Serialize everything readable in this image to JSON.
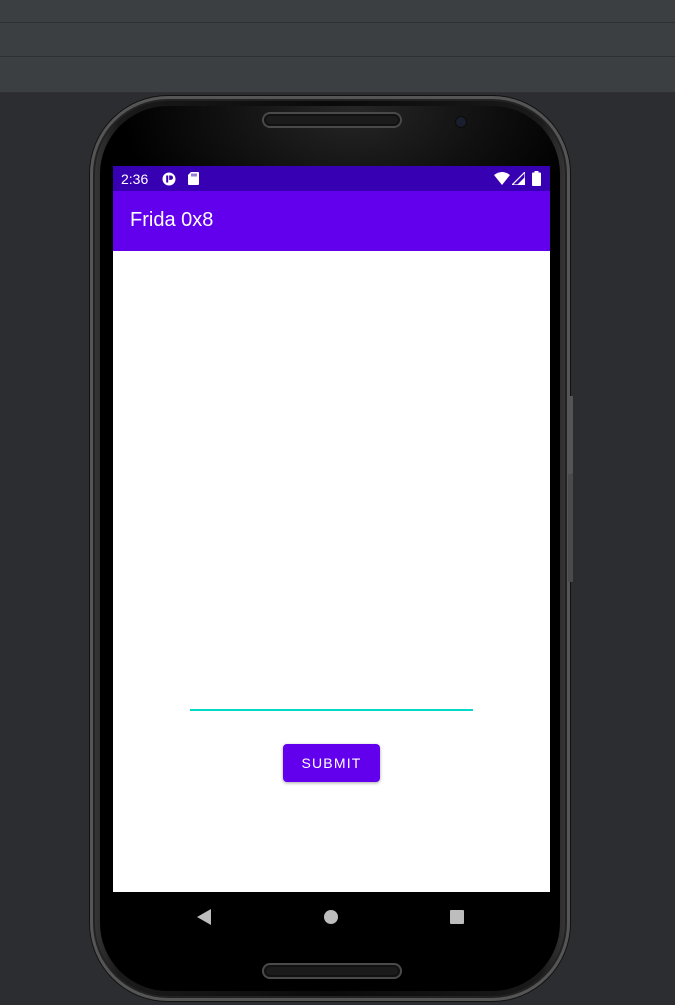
{
  "status_bar": {
    "time": "2:36",
    "left_icons": [
      "media-playback-icon",
      "sd-card-icon"
    ],
    "right_icons": [
      "wifi-icon",
      "cell-signal-icon",
      "battery-icon"
    ],
    "color": "#3700b3"
  },
  "app_bar": {
    "title": "Frida 0x8",
    "color": "#6200ee"
  },
  "form": {
    "input_value": "",
    "input_underline_color": "#03dac5",
    "submit_label": "SUBMIT",
    "submit_color": "#6200ee"
  },
  "nav_bar": {
    "buttons": [
      "back-icon",
      "home-icon",
      "recents-icon"
    ]
  }
}
